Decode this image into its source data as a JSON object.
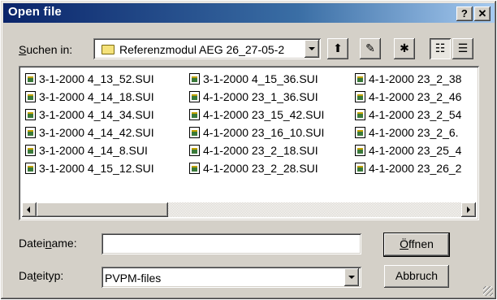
{
  "window": {
    "title": "Open file",
    "help_label": "?",
    "close_label": "✕"
  },
  "lookin": {
    "label_prefix": "S",
    "label_rest": "uchen in:",
    "value": "Referenzmodul AEG 26_27-05-2"
  },
  "toolbar": {
    "icons": [
      "up-folder-icon",
      "desktop-icon",
      "new-folder-icon",
      "list-view-icon",
      "details-view-icon"
    ],
    "up_glyph": "⬆",
    "desktop_glyph": "✎",
    "new_folder_glyph": "✱",
    "list_glyph": "☷",
    "details_glyph": "☰"
  },
  "files": {
    "col1": [
      "3-1-2000  4_13_52.SUI",
      "3-1-2000  4_14_18.SUI",
      "3-1-2000  4_14_34.SUI",
      "3-1-2000  4_14_42.SUI",
      "3-1-2000  4_14_8.SUI",
      "3-1-2000  4_15_12.SUI"
    ],
    "col2": [
      "3-1-2000  4_15_36.SUI",
      "4-1-2000  23_1_36.SUI",
      "4-1-2000  23_15_42.SUI",
      "4-1-2000  23_16_10.SUI",
      "4-1-2000  23_2_18.SUI",
      "4-1-2000  23_2_28.SUI"
    ],
    "col3": [
      "4-1-2000  23_2_38",
      "4-1-2000  23_2_46",
      "4-1-2000  23_2_54",
      "4-1-2000  23_2_6.",
      "4-1-2000  23_25_4",
      "4-1-2000  23_26_2"
    ]
  },
  "filename": {
    "label_a": "Datei",
    "label_u": "n",
    "label_b": "ame:",
    "value": ""
  },
  "filetype": {
    "label_a": "Da",
    "label_u": "t",
    "label_b": "eityp:",
    "value": "PVPM-files"
  },
  "buttons": {
    "open_u": "Ö",
    "open_rest": "ffnen",
    "cancel": "Abbruch"
  }
}
